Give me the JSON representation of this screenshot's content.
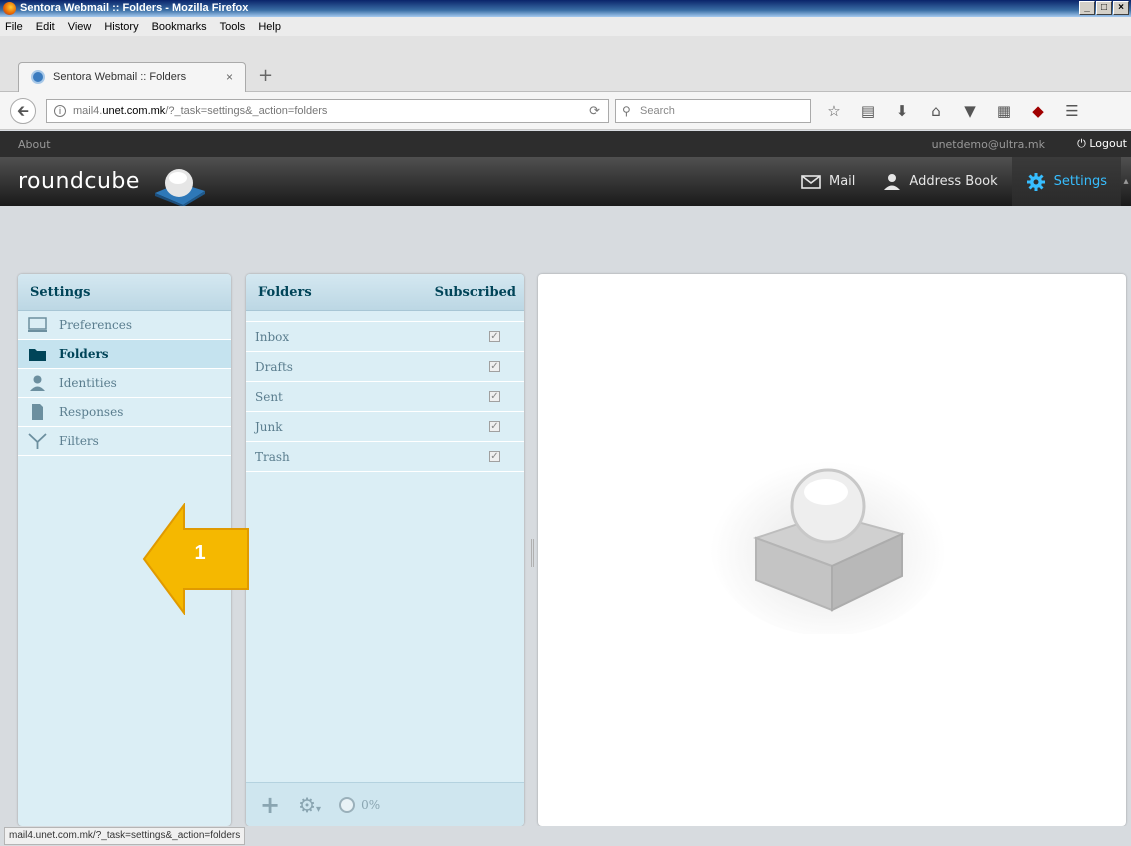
{
  "window": {
    "title": "Sentora Webmail :: Folders - Mozilla Firefox",
    "controls": [
      "_",
      "□",
      "×"
    ]
  },
  "menu": [
    "File",
    "Edit",
    "View",
    "History",
    "Bookmarks",
    "Tools",
    "Help"
  ],
  "tab": {
    "label": "Sentora Webmail :: Folders",
    "close": "×",
    "new_tab": "+"
  },
  "address": {
    "prefix": "mail4.",
    "domain": "unet.com.mk",
    "path": "/?_task=settings&_action=folders",
    "search_placeholder": "Search"
  },
  "roundcube": {
    "about": "About",
    "user": "unetdemo@ultra.mk",
    "logout": "Logout",
    "logo": "roundcube",
    "nav": {
      "mail": "Mail",
      "address_book": "Address Book",
      "settings": "Settings"
    },
    "settings_panel": {
      "title": "Settings",
      "items": [
        {
          "label": "Preferences",
          "icon": "monitor-icon"
        },
        {
          "label": "Folders",
          "icon": "folder-icon",
          "selected": true
        },
        {
          "label": "Identities",
          "icon": "person-icon"
        },
        {
          "label": "Responses",
          "icon": "document-icon"
        },
        {
          "label": "Filters",
          "icon": "filter-icon"
        }
      ]
    },
    "folders_panel": {
      "title": "Folders",
      "subscribed_label": "Subscribed",
      "folders": [
        {
          "name": "Inbox",
          "subscribed": true
        },
        {
          "name": "Drafts",
          "subscribed": true
        },
        {
          "name": "Sent",
          "subscribed": true
        },
        {
          "name": "Junk",
          "subscribed": true
        },
        {
          "name": "Trash",
          "subscribed": true
        }
      ],
      "quota": "0%"
    }
  },
  "annotation": {
    "number": "1",
    "color": "#f5b800"
  },
  "status_bar": "mail4.unet.com.mk/?_task=settings&_action=folders"
}
